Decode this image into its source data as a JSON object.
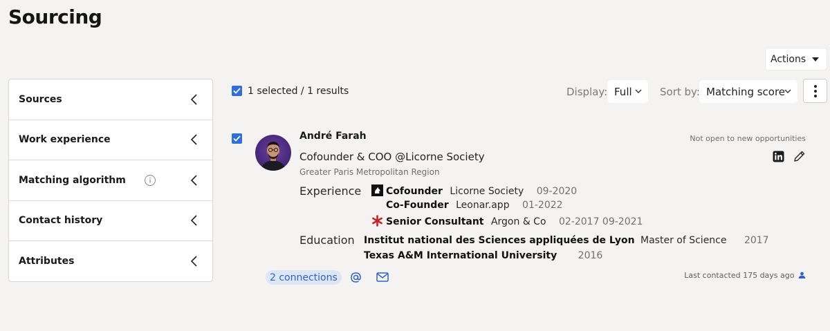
{
  "page": {
    "title": "Sourcing"
  },
  "toolbar": {
    "actions_label": "Actions"
  },
  "sidebar": {
    "items": [
      {
        "label": "Sources"
      },
      {
        "label": "Work experience"
      },
      {
        "label": "Matching algorithm",
        "has_info": true
      },
      {
        "label": "Contact history"
      },
      {
        "label": "Attributes"
      }
    ]
  },
  "results": {
    "count_text": "1 selected / 1 results",
    "display_label": "Display:",
    "display_value": "Full",
    "sort_label": "Sort by:",
    "sort_value": "Matching score"
  },
  "candidate": {
    "name": "André Farah",
    "headline": "Cofounder & COO @Licorne Society",
    "location": "Greater Paris Metropolitan Region",
    "status": "Not open to new opportunities",
    "experience_label": "Experience",
    "experience": [
      {
        "title": "Cofounder",
        "company": "Licorne Society",
        "dates": "09-2020",
        "logo": "licorne-logo"
      },
      {
        "title": "Co-Founder",
        "company": "Leonar.app",
        "dates": "01-2022",
        "logo": ""
      },
      {
        "title": "Senior Consultant",
        "company": "Argon & Co",
        "dates": "02-2017 09-2021",
        "logo": "argon-logo"
      }
    ],
    "education_label": "Education",
    "education": [
      {
        "school": "Institut national des Sciences appliquées de Lyon",
        "degree": "Master of Science",
        "year": "2017"
      },
      {
        "school": "Texas A&M International University",
        "degree": "",
        "year": "2016"
      }
    ],
    "connections": "2 connections",
    "last_contacted": "Last contacted 175 days ago"
  },
  "colors": {
    "accent": "#2f6fdc",
    "pill_bg": "#dde6f6",
    "argon_red": "#c8232c"
  },
  "icons": [
    "chevron-left-icon",
    "info-icon",
    "checkbox-checked-icon",
    "chevron-down-icon",
    "kebab-icon",
    "linkedin-icon",
    "pencil-icon",
    "at-icon",
    "mail-icon",
    "contact-person-icon"
  ]
}
